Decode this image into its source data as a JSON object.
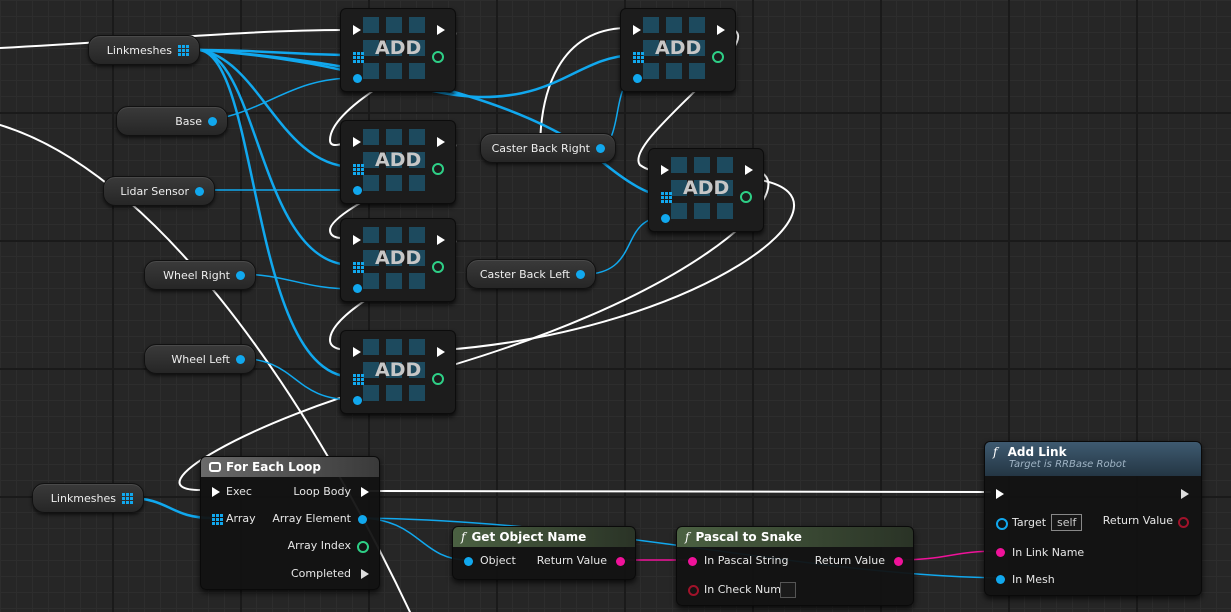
{
  "variables": {
    "linkmeshes_top": "Linkmeshes",
    "base": "Base",
    "lidar_sensor": "Lidar Sensor",
    "wheel_right": "Wheel Right",
    "wheel_left": "Wheel Left",
    "caster_back_right": "Caster Back Right",
    "caster_back_left": "Caster Back Left",
    "linkmeshes_bottom": "Linkmeshes"
  },
  "add_nodes": {
    "title": "ADD"
  },
  "for_each_loop": {
    "title": "For Each Loop",
    "exec": "Exec",
    "array": "Array",
    "loop_body": "Loop Body",
    "array_element": "Array Element",
    "array_index": "Array Index",
    "completed": "Completed"
  },
  "get_object_name": {
    "title": "Get Object Name",
    "input": "Object",
    "output": "Return Value"
  },
  "pascal_to_snake": {
    "title": "Pascal to Snake",
    "input1": "In Pascal String",
    "input2": "In Check Num",
    "output": "Return Value"
  },
  "add_link": {
    "title": "Add Link",
    "subtitle": "Target is RRBase Robot",
    "target": "Target",
    "target_value": "self",
    "return_value": "Return Value",
    "in_link_name": "In Link Name",
    "in_mesh": "In Mesh"
  },
  "colors": {
    "object_pin": "#11a8ee",
    "string_pin": "#f0129a",
    "integer_pin": "#2ecf86",
    "exec_wire": "#ffffff",
    "function_header": "#3d4f35",
    "add_link_header": "#3a5466"
  }
}
